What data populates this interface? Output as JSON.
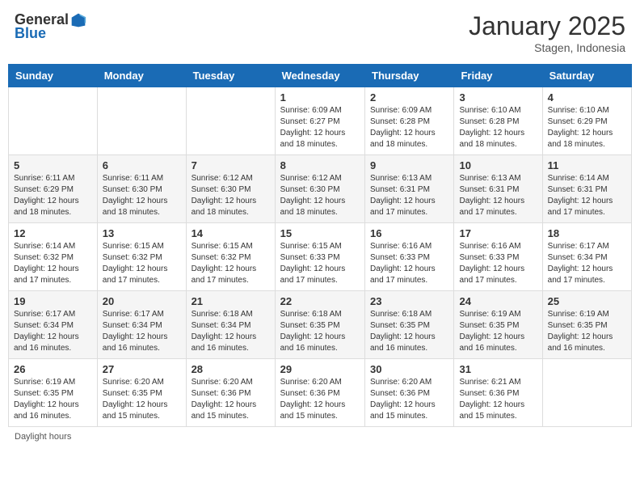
{
  "header": {
    "logo_general": "General",
    "logo_blue": "Blue",
    "month_title": "January 2025",
    "location": "Stagen, Indonesia"
  },
  "days_of_week": [
    "Sunday",
    "Monday",
    "Tuesday",
    "Wednesday",
    "Thursday",
    "Friday",
    "Saturday"
  ],
  "weeks": [
    [
      {
        "day": "",
        "info": ""
      },
      {
        "day": "",
        "info": ""
      },
      {
        "day": "",
        "info": ""
      },
      {
        "day": "1",
        "info": "Sunrise: 6:09 AM\nSunset: 6:27 PM\nDaylight: 12 hours and 18 minutes."
      },
      {
        "day": "2",
        "info": "Sunrise: 6:09 AM\nSunset: 6:28 PM\nDaylight: 12 hours and 18 minutes."
      },
      {
        "day": "3",
        "info": "Sunrise: 6:10 AM\nSunset: 6:28 PM\nDaylight: 12 hours and 18 minutes."
      },
      {
        "day": "4",
        "info": "Sunrise: 6:10 AM\nSunset: 6:29 PM\nDaylight: 12 hours and 18 minutes."
      }
    ],
    [
      {
        "day": "5",
        "info": "Sunrise: 6:11 AM\nSunset: 6:29 PM\nDaylight: 12 hours and 18 minutes."
      },
      {
        "day": "6",
        "info": "Sunrise: 6:11 AM\nSunset: 6:30 PM\nDaylight: 12 hours and 18 minutes."
      },
      {
        "day": "7",
        "info": "Sunrise: 6:12 AM\nSunset: 6:30 PM\nDaylight: 12 hours and 18 minutes."
      },
      {
        "day": "8",
        "info": "Sunrise: 6:12 AM\nSunset: 6:30 PM\nDaylight: 12 hours and 18 minutes."
      },
      {
        "day": "9",
        "info": "Sunrise: 6:13 AM\nSunset: 6:31 PM\nDaylight: 12 hours and 17 minutes."
      },
      {
        "day": "10",
        "info": "Sunrise: 6:13 AM\nSunset: 6:31 PM\nDaylight: 12 hours and 17 minutes."
      },
      {
        "day": "11",
        "info": "Sunrise: 6:14 AM\nSunset: 6:31 PM\nDaylight: 12 hours and 17 minutes."
      }
    ],
    [
      {
        "day": "12",
        "info": "Sunrise: 6:14 AM\nSunset: 6:32 PM\nDaylight: 12 hours and 17 minutes."
      },
      {
        "day": "13",
        "info": "Sunrise: 6:15 AM\nSunset: 6:32 PM\nDaylight: 12 hours and 17 minutes."
      },
      {
        "day": "14",
        "info": "Sunrise: 6:15 AM\nSunset: 6:32 PM\nDaylight: 12 hours and 17 minutes."
      },
      {
        "day": "15",
        "info": "Sunrise: 6:15 AM\nSunset: 6:33 PM\nDaylight: 12 hours and 17 minutes."
      },
      {
        "day": "16",
        "info": "Sunrise: 6:16 AM\nSunset: 6:33 PM\nDaylight: 12 hours and 17 minutes."
      },
      {
        "day": "17",
        "info": "Sunrise: 6:16 AM\nSunset: 6:33 PM\nDaylight: 12 hours and 17 minutes."
      },
      {
        "day": "18",
        "info": "Sunrise: 6:17 AM\nSunset: 6:34 PM\nDaylight: 12 hours and 17 minutes."
      }
    ],
    [
      {
        "day": "19",
        "info": "Sunrise: 6:17 AM\nSunset: 6:34 PM\nDaylight: 12 hours and 16 minutes."
      },
      {
        "day": "20",
        "info": "Sunrise: 6:17 AM\nSunset: 6:34 PM\nDaylight: 12 hours and 16 minutes."
      },
      {
        "day": "21",
        "info": "Sunrise: 6:18 AM\nSunset: 6:34 PM\nDaylight: 12 hours and 16 minutes."
      },
      {
        "day": "22",
        "info": "Sunrise: 6:18 AM\nSunset: 6:35 PM\nDaylight: 12 hours and 16 minutes."
      },
      {
        "day": "23",
        "info": "Sunrise: 6:18 AM\nSunset: 6:35 PM\nDaylight: 12 hours and 16 minutes."
      },
      {
        "day": "24",
        "info": "Sunrise: 6:19 AM\nSunset: 6:35 PM\nDaylight: 12 hours and 16 minutes."
      },
      {
        "day": "25",
        "info": "Sunrise: 6:19 AM\nSunset: 6:35 PM\nDaylight: 12 hours and 16 minutes."
      }
    ],
    [
      {
        "day": "26",
        "info": "Sunrise: 6:19 AM\nSunset: 6:35 PM\nDaylight: 12 hours and 16 minutes."
      },
      {
        "day": "27",
        "info": "Sunrise: 6:20 AM\nSunset: 6:35 PM\nDaylight: 12 hours and 15 minutes."
      },
      {
        "day": "28",
        "info": "Sunrise: 6:20 AM\nSunset: 6:36 PM\nDaylight: 12 hours and 15 minutes."
      },
      {
        "day": "29",
        "info": "Sunrise: 6:20 AM\nSunset: 6:36 PM\nDaylight: 12 hours and 15 minutes."
      },
      {
        "day": "30",
        "info": "Sunrise: 6:20 AM\nSunset: 6:36 PM\nDaylight: 12 hours and 15 minutes."
      },
      {
        "day": "31",
        "info": "Sunrise: 6:21 AM\nSunset: 6:36 PM\nDaylight: 12 hours and 15 minutes."
      },
      {
        "day": "",
        "info": ""
      }
    ]
  ],
  "footer": {
    "daylight_label": "Daylight hours"
  }
}
